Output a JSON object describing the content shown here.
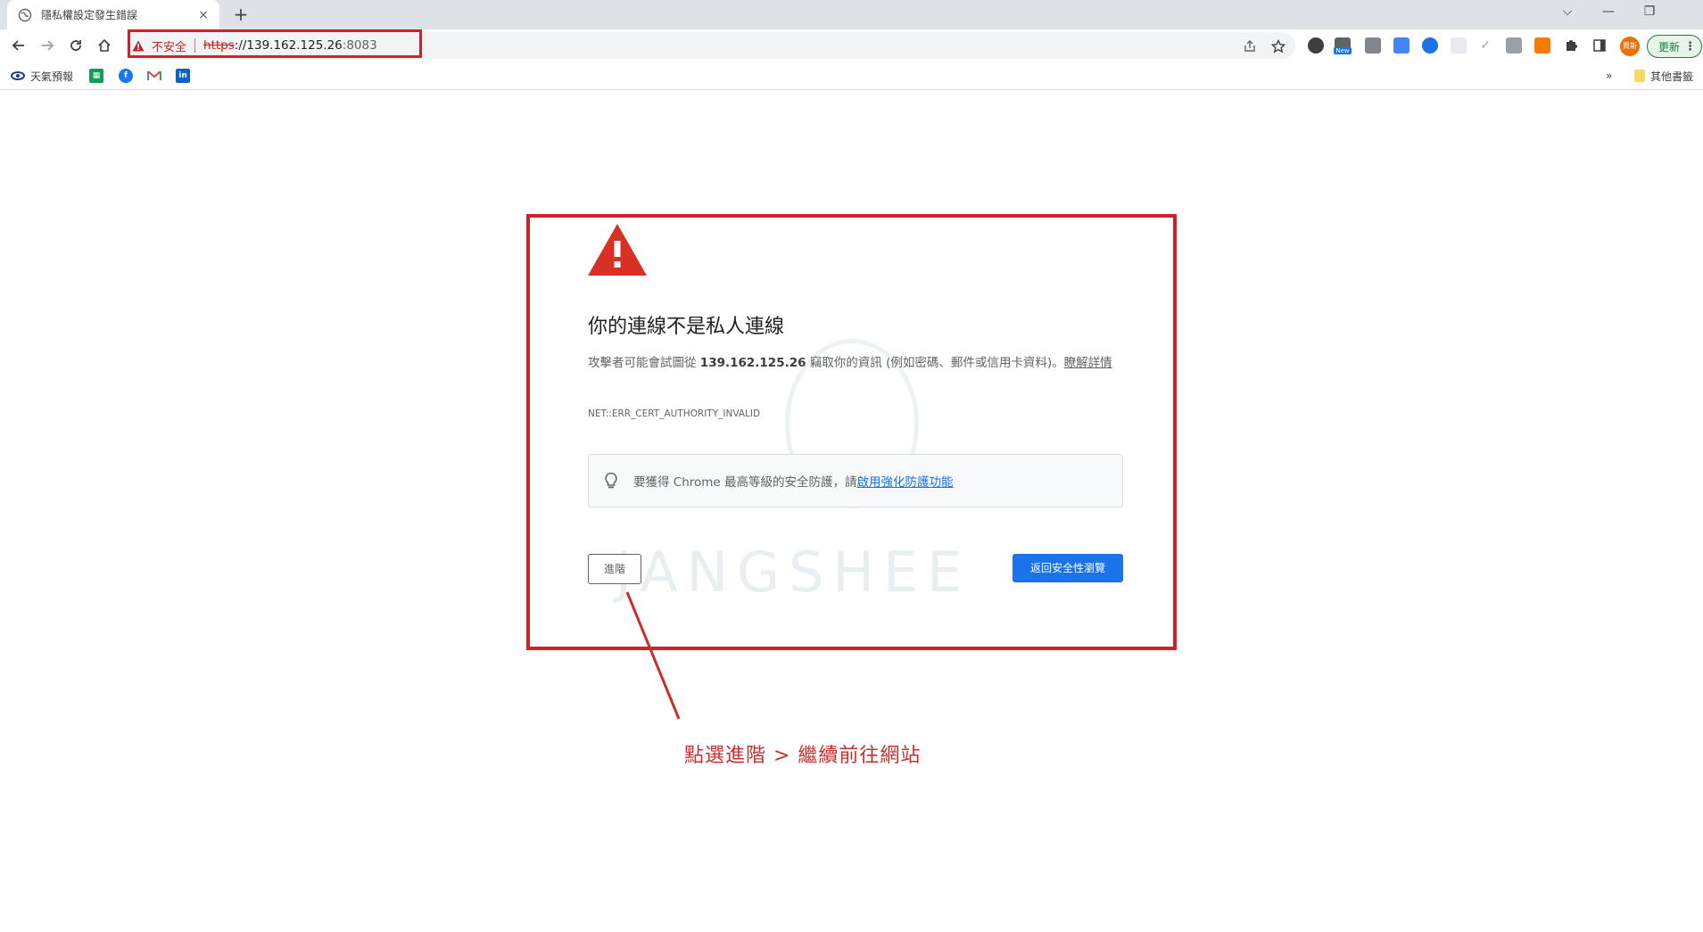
{
  "browser": {
    "tab": {
      "title": "隱私權設定發生錯誤",
      "close": "×"
    },
    "new_tab": "+",
    "window_controls": {
      "tabs_menu": "⌵",
      "minimize": "—",
      "restore": "❐"
    },
    "omnibox": {
      "not_secure": "不安全",
      "url_scheme": "https",
      "url_host": "://139.162.125.26",
      "url_port": ":8083"
    },
    "extensions": {
      "new_badge": "New"
    },
    "profile_label": "賈斯",
    "update_label": "更新",
    "update_menu": "⋮",
    "colors": {
      "tabstrip": "#dee1e6",
      "not_secure": "#c5221f",
      "update_green": "#188038"
    }
  },
  "bookmarks": {
    "items": [
      {
        "label": "天氣預報"
      },
      {
        "label": ""
      },
      {
        "label": ""
      },
      {
        "label": ""
      },
      {
        "label": ""
      }
    ],
    "overflow": "»",
    "other": "其他書籤"
  },
  "interstitial": {
    "heading": "你的連線不是私人連線",
    "body_prefix": "攻擊者可能會試圖從 ",
    "body_host": "139.162.125.26",
    "body_suffix": " 竊取你的資訊 (例如密碼、郵件或信用卡資料)。",
    "learn_more": "瞭解詳情",
    "error_code": "NET::ERR_CERT_AUTHORITY_INVALID",
    "tip_prefix": "要獲得 Chrome 最高等級的安全防護，請",
    "tip_link": "啟用強化防護功能",
    "advanced_button": "進階",
    "back_button": "返回安全性瀏覽",
    "colors": {
      "primary": "#1a73e8",
      "warning_red": "#d93025"
    }
  },
  "annotation": {
    "text": "點選進階 > 繼續前往網站",
    "color": "#c8302f"
  },
  "watermark": {
    "text": "JANGSHEE"
  }
}
